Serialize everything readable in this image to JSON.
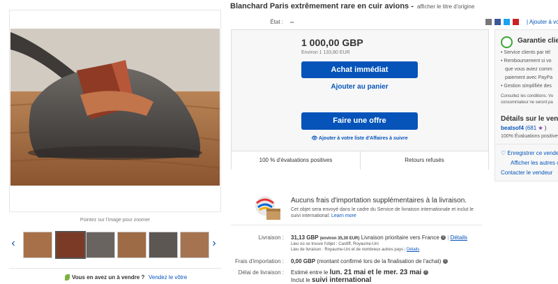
{
  "listing": {
    "title": "Blanchard Paris extrêmement rare en cuir avions -",
    "show_original": "afficher le titre d'origine",
    "state_label": "État :",
    "state_value": "--"
  },
  "gallery": {
    "zoom_hint": "Pointez sur l'image pour zoomer",
    "sell_question": "Vous en avez un à vendre ?",
    "sell_link": "Vendez le vôtre"
  },
  "share": {
    "add_watch": "| Ajouter à vos"
  },
  "buybox": {
    "price": "1 000,00 GBP",
    "price_approx": "Environ 1 133,80 EUR",
    "buy_now": "Achat immédiat",
    "add_cart": "Ajouter au panier",
    "make_offer": "Faire une offre",
    "watch": "Ajouter à votre liste d'Affaires à suivre",
    "positive": "100 % d'évaluations positives",
    "returns": "Retours refusés"
  },
  "shipping": {
    "title": "Aucuns frais d'importation supplémentaires à la livraison.",
    "desc": "Cet objet sera envoyé dans le cadre du Service de livraison internationale et inclut le suivi international.",
    "learn_more": "Learn more",
    "delivery_label": "Livraison :",
    "delivery_price": "31,13 GBP",
    "delivery_approx": "(environ 35,30 EUR)",
    "delivery_service": "Livraison prioritaire vers France",
    "details": "Détails",
    "location_prefix": "Lieu où se trouve l'objet :",
    "location": "Cardiff, Royaume-Uni",
    "destinations_prefix": "Lieu de livraison :",
    "destinations": "Royaume-Uni et de nombreux autres pays",
    "destinations_details": "Détails",
    "import_label": "Frais d'importation :",
    "import_value": "0,00 GBP",
    "import_note": "(montant confirmé lors de la finalisation de l'achat)",
    "delay_label": "Délai de livraison :",
    "delay_prefix": "Estimé entre le",
    "delay_dates": "lun. 21 mai et le mer. 23 mai",
    "delay_track_prefix": "Inclut le",
    "delay_track": "suivi international"
  },
  "guarantee": {
    "title": "Garantie clie",
    "items": [
      "• Service clients par tél",
      "• Remboursement si vo",
      "  que vous aviez comm",
      "  paiement avec PayPa",
      "• Gestion simplifiée des"
    ],
    "terms1": "Consultez les conditions. Vo",
    "terms2": "consommateur ne seront pa"
  },
  "seller": {
    "title": "Détails sur le vend",
    "name": "beatsof4",
    "score": "(681",
    "score_end": ")",
    "positive": "100% Évaluations positive",
    "save": "Enregistrer ce vende",
    "other_items": "Afficher les autres o",
    "contact": "Contacter le vendeur"
  },
  "colors": {
    "accent": "#0654ba",
    "guarantee_green": "#3aa835"
  }
}
